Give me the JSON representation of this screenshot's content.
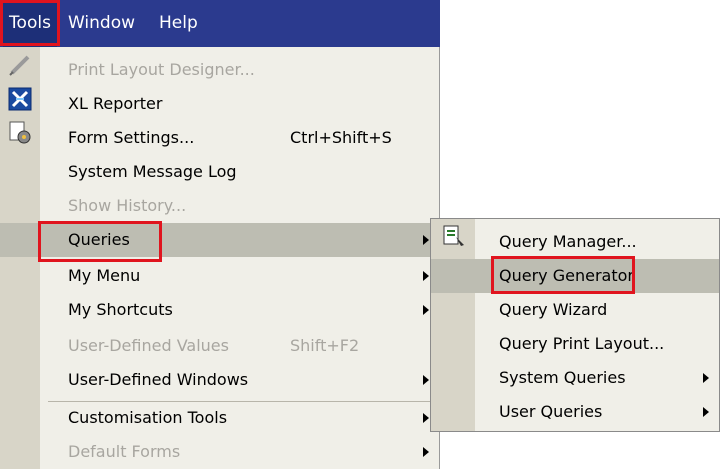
{
  "menubar": {
    "tools": "Tools",
    "window": "Window",
    "help": "Help"
  },
  "tools_menu": {
    "items": [
      {
        "label": "Print Layout Designer...",
        "enabled": false,
        "icon": "pencil-icon"
      },
      {
        "label": "XL Reporter",
        "enabled": true,
        "icon": "xl-reporter-icon"
      },
      {
        "label": "Form Settings...",
        "shortcut": "Ctrl+Shift+S",
        "enabled": true,
        "icon": "form-settings-icon"
      },
      {
        "label": "System Message Log",
        "enabled": true
      },
      {
        "label": "Show History...",
        "enabled": false
      },
      {
        "label": "Queries",
        "enabled": true,
        "submenu": true,
        "highlighted": true
      },
      {
        "label": "My Menu",
        "enabled": true,
        "submenu": true
      },
      {
        "label": "My Shortcuts",
        "enabled": true,
        "submenu": true
      },
      {
        "label": "User-Defined Values",
        "shortcut": "Shift+F2",
        "enabled": false
      },
      {
        "label": "User-Defined Windows",
        "enabled": true,
        "submenu": true
      },
      {
        "label": "Customisation Tools",
        "enabled": true,
        "submenu": true
      },
      {
        "label": "Default Forms",
        "enabled": false,
        "submenu": true
      }
    ]
  },
  "queries_submenu": {
    "items": [
      {
        "label": "Query Manager...",
        "icon": "query-manager-icon"
      },
      {
        "label": "Query Generator",
        "highlighted": true
      },
      {
        "label": "Query Wizard"
      },
      {
        "label": "Query Print Layout..."
      },
      {
        "label": "System Queries",
        "submenu": true
      },
      {
        "label": "User Queries",
        "submenu": true
      }
    ]
  },
  "colors": {
    "menubar": "#2b3a8e",
    "menu_background": "#f0efe8",
    "highlight": "#bdbdb2",
    "annotation": "#e0141e"
  }
}
